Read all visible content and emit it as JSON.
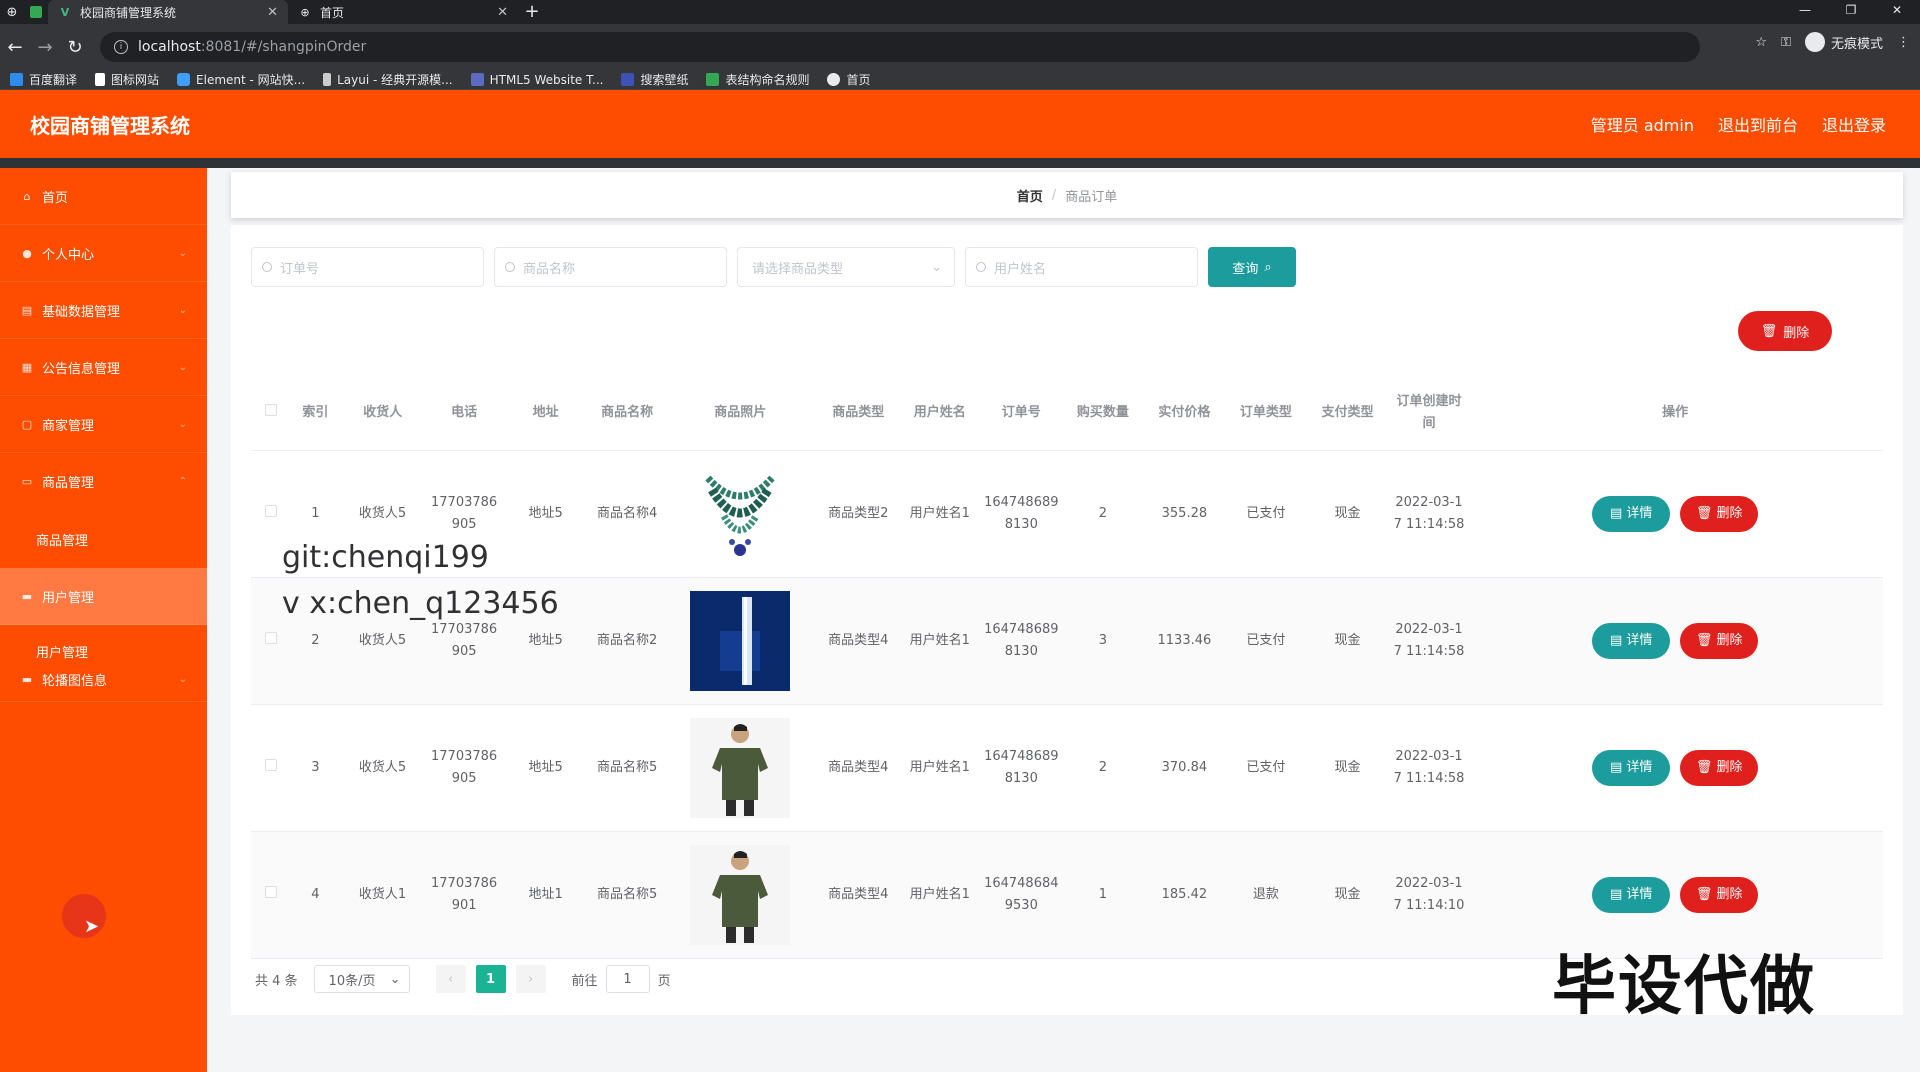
{
  "browser": {
    "tabs": [
      {
        "title": "校园商铺管理系统",
        "active": true
      },
      {
        "title": "首页",
        "active": false
      }
    ],
    "url_host": "localhost",
    "url_path": ":8081/#/shangpinOrder",
    "incognito_label": "无痕模式",
    "bookmarks": [
      {
        "label": "百度翻译",
        "color": "#2d8cf0"
      },
      {
        "label": "图标网站",
        "color": "#ffffff"
      },
      {
        "label": "Element - 网站快...",
        "color": "#409eff"
      },
      {
        "label": "Layui - 经典开源模...",
        "color": "#cccccc"
      },
      {
        "label": "HTML5 Website T...",
        "color": "#5c6bc0"
      },
      {
        "label": "搜索壁纸",
        "color": "#3f51b5"
      },
      {
        "label": "表结构命名规则",
        "color": "#34a853"
      },
      {
        "label": "首页",
        "color": "#e8eaed"
      }
    ]
  },
  "header": {
    "title": "校园商铺管理系统",
    "admin_label": "管理员 admin",
    "back_front": "退出到前台",
    "logout": "退出登录",
    "accent": "#ff4d00"
  },
  "sidebar": {
    "items": [
      {
        "label": "首页",
        "icon": "home-icon"
      },
      {
        "label": "个人中心",
        "icon": "user-icon"
      },
      {
        "label": "基础数据管理",
        "icon": "database-icon"
      },
      {
        "label": "公告信息管理",
        "icon": "notice-icon"
      },
      {
        "label": "商家管理",
        "icon": "shop-icon"
      },
      {
        "label": "商品管理",
        "icon": "goods-icon"
      }
    ],
    "goods_sub": "商品管理",
    "user_item": "用户管理",
    "user_sub": "用户管理",
    "carousel_item": "轮播图信息"
  },
  "breadcrumb": {
    "home": "首页",
    "separator": "/",
    "current": "商品订单"
  },
  "search": {
    "order_no_placeholder": "订单号",
    "goods_name_placeholder": "商品名称",
    "goods_type_placeholder": "请选择商品类型",
    "user_name_placeholder": "用户姓名",
    "query_label": "查询"
  },
  "delete_label": "删除",
  "table": {
    "headers": [
      "索引",
      "收货人",
      "电话",
      "地址",
      "商品名称",
      "商品照片",
      "商品类型",
      "用户姓名",
      "订单号",
      "购买数量",
      "实付价格",
      "订单类型",
      "支付类型",
      "订单创建时间",
      "操作"
    ],
    "rows": [
      {
        "index": "1",
        "receiver": "收货人5",
        "phone": "17703786905",
        "address": "地址5",
        "goods_name": "商品名称4",
        "photo": "necklace",
        "goods_type": "商品类型2",
        "user_name": "用户姓名1",
        "order_no": "1647486898130",
        "qty": "2",
        "price": "355.28",
        "order_type": "已支付",
        "pay_type": "现金",
        "created": "2022-03-17 11:14:58"
      },
      {
        "index": "2",
        "receiver": "收货人5",
        "phone": "17703786905",
        "address": "地址5",
        "goods_name": "商品名称2",
        "photo": "serum",
        "goods_type": "商品类型4",
        "user_name": "用户姓名1",
        "order_no": "1647486898130",
        "qty": "3",
        "price": "1133.46",
        "order_type": "已支付",
        "pay_type": "现金",
        "created": "2022-03-17 11:14:58"
      },
      {
        "index": "3",
        "receiver": "收货人5",
        "phone": "17703786905",
        "address": "地址5",
        "goods_name": "商品名称5",
        "photo": "tshirt",
        "goods_type": "商品类型4",
        "user_name": "用户姓名1",
        "order_no": "1647486898130",
        "qty": "2",
        "price": "370.84",
        "order_type": "已支付",
        "pay_type": "现金",
        "created": "2022-03-17 11:14:58"
      },
      {
        "index": "4",
        "receiver": "收货人1",
        "phone": "17703786901",
        "address": "地址1",
        "goods_name": "商品名称5",
        "photo": "tshirt",
        "goods_type": "商品类型4",
        "user_name": "用户姓名1",
        "order_no": "1647486849530",
        "qty": "1",
        "price": "185.42",
        "order_type": "退款",
        "pay_type": "现金",
        "created": "2022-03-17 11:14:10"
      }
    ],
    "detail_label": "详情",
    "delete_label": "删除"
  },
  "pager": {
    "total": "共 4 条",
    "page_size": "10条/页",
    "current_page": "1",
    "goto_label": "前往",
    "goto_value": "1",
    "page_suffix": "页"
  },
  "watermarks": {
    "git": "git:chenqi199",
    "vx": "v x:chen_q123456",
    "corner": "毕设代做"
  },
  "colors": {
    "teal": "#1c9c9c",
    "red": "#e0201c",
    "orange": "#ff4d00",
    "pager_active": "#1ab394"
  }
}
